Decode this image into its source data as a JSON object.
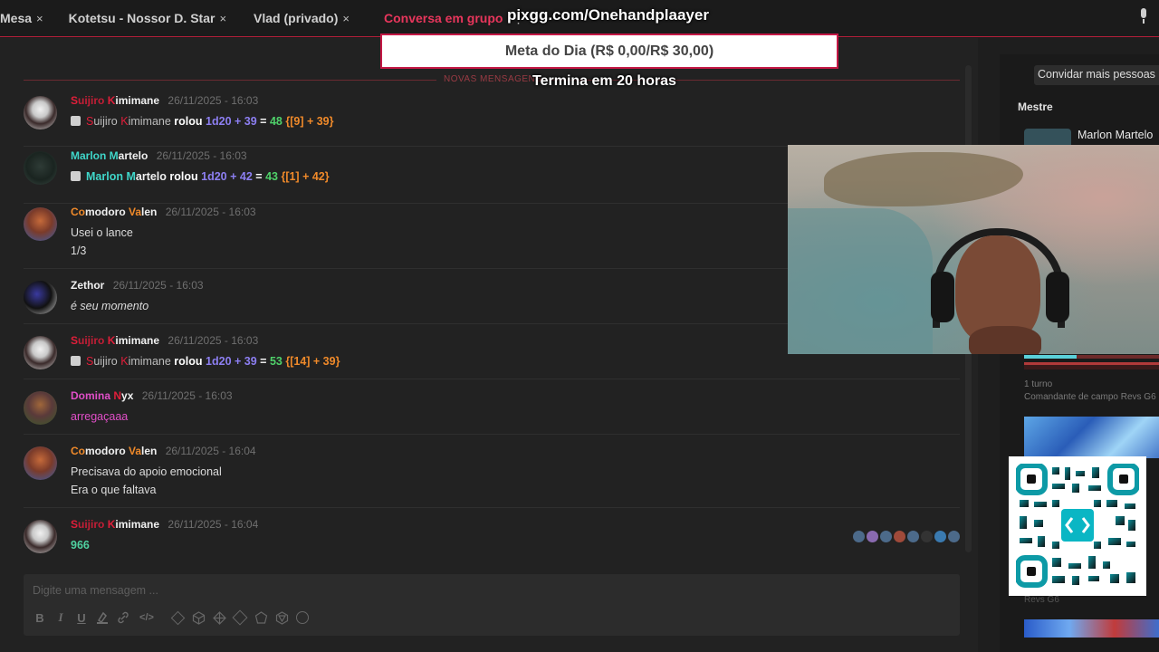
{
  "tabs": [
    {
      "label": "Mesa",
      "active": false
    },
    {
      "label": "Kotetsu - Nossor D. Star",
      "active": false
    },
    {
      "label": "Vlad (privado)",
      "active": false
    },
    {
      "label": "Conversa em grupo",
      "active": true
    }
  ],
  "tab_close_glyph": "×",
  "tab_more_glyph": "⋮",
  "overlay": {
    "url": "pixgg.com/Onehandplaayer",
    "goal": "Meta do Dia (R$ 0,00/R$ 30,00)",
    "ends": "Termina em 20 horas"
  },
  "chat": {
    "new_messages_label": "NOVAS MENSAGENS",
    "messages": [
      {
        "name_first": "S",
        "name_mid": "uijiro ",
        "name_k": "K",
        "name_rest": "imimane",
        "time": "26/11/2025 - 16:03",
        "roll": {
          "who_first": "S",
          "who_mid": "uijiro ",
          "who_k": "K",
          "who_rest": "imimane",
          "verb": "rolou",
          "formula": "1d20 + 39",
          "eq": "=",
          "total": "48",
          "detail": "{[9] + 39}"
        }
      },
      {
        "name_first": "Marlon ",
        "name_m": "M",
        "name_rest": "artelo",
        "time": "26/11/2025 - 16:03",
        "roll": {
          "who_first": "Marlon ",
          "who_m": "M",
          "who_rest": "artelo",
          "verb": "rolou",
          "formula": "1d20 + 42",
          "eq": "=",
          "total": "43",
          "detail": "{[1] + 42}"
        }
      },
      {
        "name_co": "Co",
        "name_mid": "modoro ",
        "name_va": "Va",
        "name_rest": "len",
        "time": "26/11/2025 - 16:03",
        "lines": [
          "Usei o lance",
          "1/3"
        ]
      },
      {
        "name": "Zethor",
        "time": "26/11/2025 - 16:03",
        "lines": [
          "é seu momento"
        ]
      },
      {
        "name_first": "S",
        "name_mid": "uijiro ",
        "name_k": "K",
        "name_rest": "imimane",
        "time": "26/11/2025 - 16:03",
        "roll": {
          "who_first": "S",
          "who_mid": "uijiro ",
          "who_k": "K",
          "who_rest": "imimane",
          "verb": "rolou",
          "formula": "1d20 + 39",
          "eq": "=",
          "total": "53",
          "detail": "{[14] + 39}"
        }
      },
      {
        "name_first": "Domina ",
        "name_n": "N",
        "name_rest": "yx",
        "time": "26/11/2025 - 16:03",
        "lines": [
          "arregaçaaa"
        ]
      },
      {
        "name_co": "Co",
        "name_mid": "modoro ",
        "name_va": "Va",
        "name_rest": "len",
        "time": "26/11/2025 - 16:04",
        "lines": [
          "Precisava do apoio emocional",
          "Era o que faltava"
        ]
      },
      {
        "name_first": "S",
        "name_mid": "uijiro ",
        "name_k": "K",
        "name_rest": "imimane",
        "time": "26/11/2025 - 16:04",
        "lines": [
          "966"
        ]
      }
    ],
    "composer_placeholder": "Digite uma mensagem ..."
  },
  "toolbar": {
    "bold": "B",
    "italic": "I",
    "underline": "U",
    "code": "</>"
  },
  "sidebar": {
    "invite": "Convidar mais pessoas",
    "section": "Mestre",
    "player": "Marlon Martelo",
    "turn": "1 turno",
    "role": "Comandante de campo Revs G6",
    "revs": "Revs G6"
  },
  "colors": {
    "accent": "#e8365c",
    "background": "#222222",
    "roll_formula": "#8d7ff2",
    "roll_total": "#4fd16a",
    "roll_detail": "#f08a2a"
  }
}
